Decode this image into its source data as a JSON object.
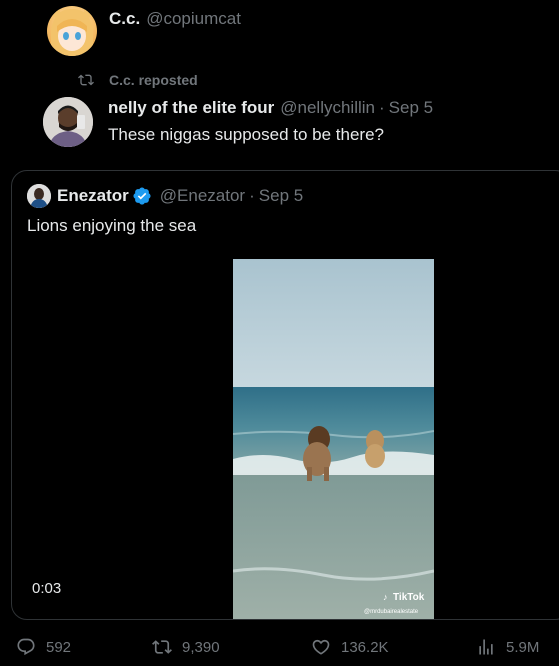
{
  "top_user": {
    "display_name": "C.c.",
    "handle": "@copiumcat"
  },
  "repost": {
    "label": "C.c. reposted"
  },
  "tweet": {
    "author": "nelly of the elite four",
    "handle": "@nellychillin",
    "separator": "·",
    "date": "Sep 5",
    "text": "These niggas supposed to be there?"
  },
  "quote": {
    "author": "Enezator",
    "handle": "@Enezator",
    "separator": "·",
    "date": "Sep 5",
    "text": "Lions enjoying the sea",
    "video": {
      "duration": "0:03",
      "watermark_brand": "TikTok",
      "watermark_user": "@mrdubairealestate"
    }
  },
  "actions": {
    "replies": "592",
    "reposts": "9,390",
    "likes": "136.2K",
    "views": "5.9M"
  },
  "colors": {
    "verified": "#1d9bf0",
    "muted": "#71767b",
    "border": "#2f3336"
  }
}
